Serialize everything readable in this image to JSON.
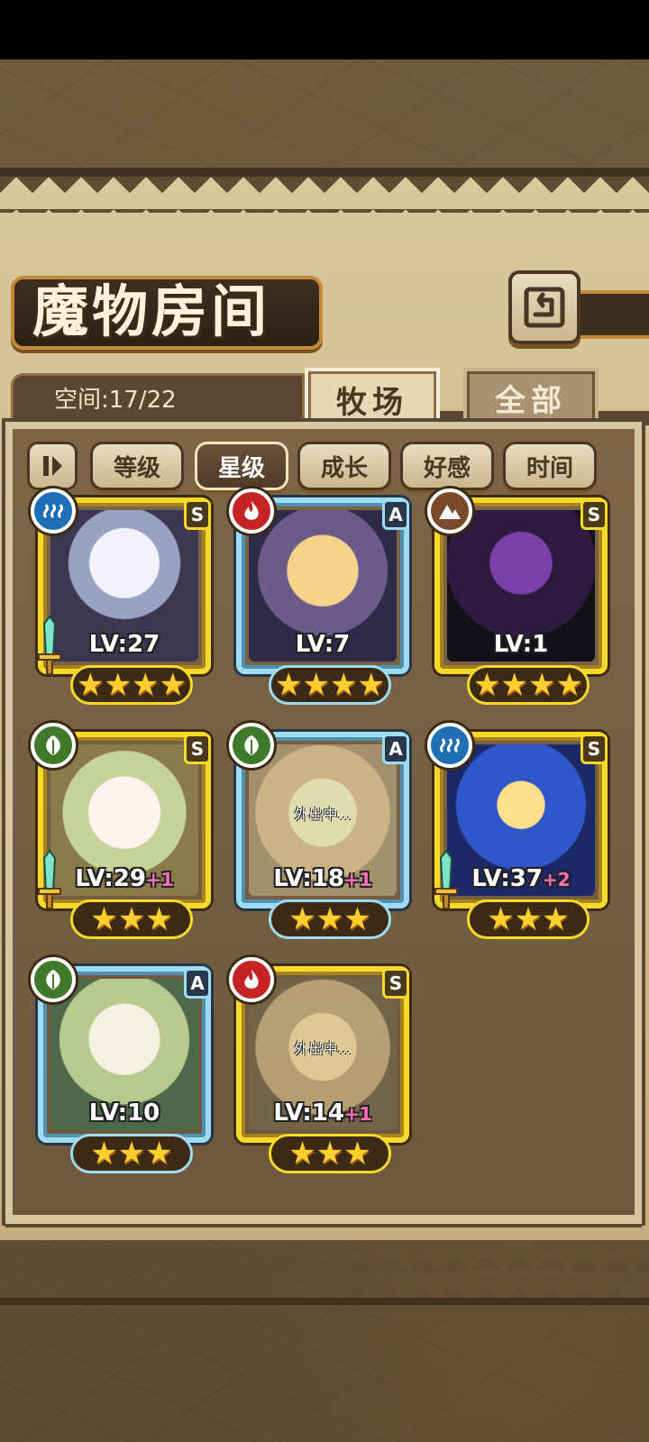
{
  "header": {
    "title": "魔物房间",
    "back_icon": "back-arrow-icon"
  },
  "storage": {
    "space_label": "空间:17/22"
  },
  "tabs": [
    {
      "label": "牧场",
      "active": true
    },
    {
      "label": "全部",
      "active": false
    }
  ],
  "sort": {
    "toggle_icon": "sort-order-icon",
    "options": [
      {
        "label": "等级",
        "active": false
      },
      {
        "label": "星级",
        "active": true
      },
      {
        "label": "成长",
        "active": false
      },
      {
        "label": "好感",
        "active": false
      },
      {
        "label": "时间",
        "active": false
      }
    ]
  },
  "monsters": [
    {
      "rank": "S",
      "element": "water",
      "level": "LV:27",
      "plus": "",
      "stars": 4,
      "away": "",
      "weapon": true
    },
    {
      "rank": "A",
      "element": "fire",
      "level": "LV:7",
      "plus": "",
      "stars": 4,
      "away": "",
      "weapon": false
    },
    {
      "rank": "S",
      "element": "earth",
      "level": "LV:1",
      "plus": "",
      "stars": 4,
      "away": "",
      "weapon": false
    },
    {
      "rank": "S",
      "element": "grass",
      "level": "LV:29",
      "plus": "+1",
      "stars": 3,
      "away": "",
      "weapon": true
    },
    {
      "rank": "A",
      "element": "grass",
      "level": "LV:18",
      "plus": "+1",
      "stars": 3,
      "away": "外出中...",
      "weapon": false
    },
    {
      "rank": "S",
      "element": "water",
      "level": "LV:37",
      "plus": "+2",
      "stars": 3,
      "away": "",
      "weapon": true
    },
    {
      "rank": "A",
      "element": "grass",
      "level": "LV:10",
      "plus": "",
      "stars": 3,
      "away": "",
      "weapon": false
    },
    {
      "rank": "S",
      "element": "fire",
      "level": "LV:14",
      "plus": "+1",
      "stars": 3,
      "away": "外出中...",
      "weapon": false
    }
  ],
  "colors": {
    "rank_s_frame": "#f5d92b",
    "rank_a_frame": "#9fdcf2",
    "plus_text": "#ff6fb9",
    "star": "#ffcf2e"
  }
}
